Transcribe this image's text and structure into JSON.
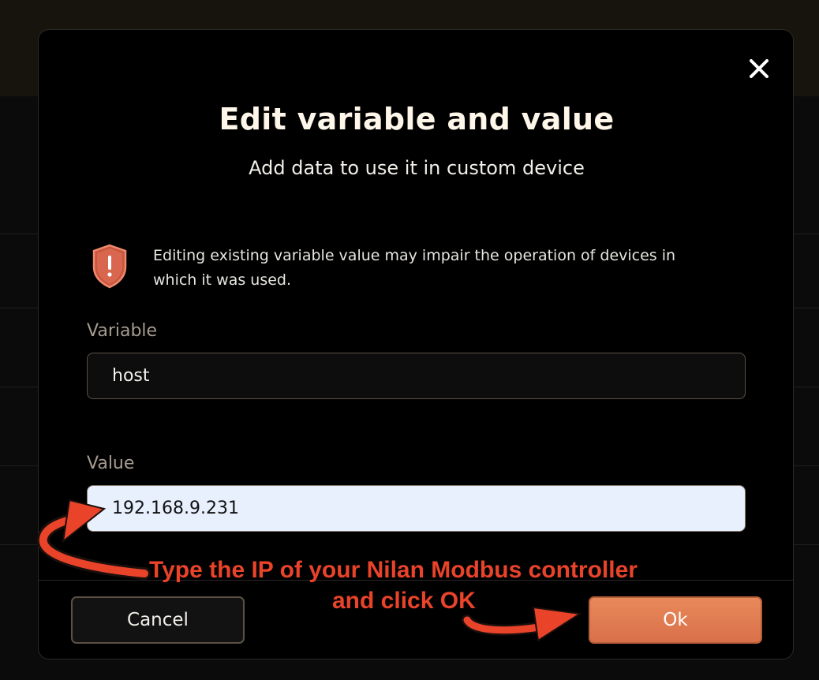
{
  "dialog": {
    "title": "Edit variable and value",
    "subtitle": "Add data to use it in custom device",
    "warning_text": "Editing existing variable value may impair the operation of devices in which it was used.",
    "close_icon": "close-icon",
    "warning_icon": "shield-alert-icon"
  },
  "fields": {
    "variable": {
      "label": "Variable",
      "value": "host"
    },
    "value": {
      "label": "Value",
      "value": "192.168.9.231"
    }
  },
  "buttons": {
    "cancel_label": "Cancel",
    "ok_label": "Ok"
  },
  "annotation": {
    "line1": "Type the IP of your Nilan Modbus controller",
    "line2": "and click OK",
    "color": "#e9432a"
  },
  "colors": {
    "accent": "#e07a50",
    "title": "#fff6ea",
    "label": "#a69c90",
    "warning_shield": "#d9674f"
  }
}
